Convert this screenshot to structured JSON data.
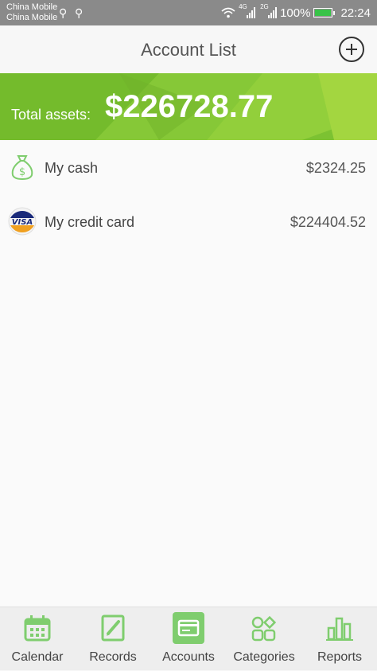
{
  "status_bar": {
    "carrier_1": "China Mobile",
    "carrier_2": "China Mobile",
    "network_1": "4G",
    "network_2": "2G",
    "battery": "100%",
    "time": "22:24"
  },
  "header": {
    "title": "Account List"
  },
  "summary": {
    "label": "Total assets:",
    "value": "$226728.77"
  },
  "accounts": [
    {
      "name": "My cash",
      "amount": "$2324.25",
      "icon": "money-bag-icon"
    },
    {
      "name": "My credit card",
      "amount": "$224404.52",
      "icon": "visa-card-icon",
      "brand": "VISA"
    }
  ],
  "nav": [
    {
      "label": "Calendar",
      "icon": "calendar-icon"
    },
    {
      "label": "Records",
      "icon": "records-icon"
    },
    {
      "label": "Accounts",
      "icon": "accounts-icon",
      "active": true
    },
    {
      "label": "Categories",
      "icon": "categories-icon"
    },
    {
      "label": "Reports",
      "icon": "reports-icon"
    }
  ],
  "colors": {
    "accent": "#7fcd6e",
    "banner": "#7ec32f",
    "status_bar": "#8a8a8a"
  }
}
